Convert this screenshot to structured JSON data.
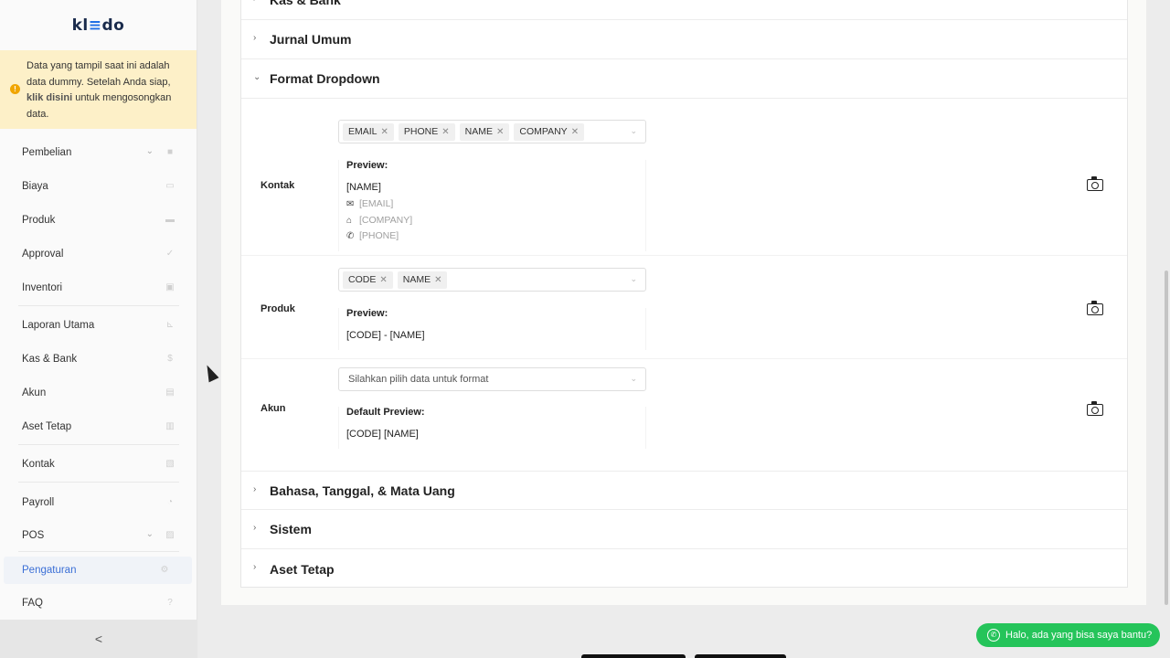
{
  "logo": {
    "text_a": "kl",
    "text_b": "≡",
    "text_c": "do"
  },
  "notice": {
    "text_before": "Data yang tampil saat ini adalah data dummy. Setelah Anda siap, ",
    "link": "klik disini",
    "text_after": " untuk mengosongkan data."
  },
  "sidebar": {
    "items": [
      {
        "label": "Pembelian",
        "icon": "bag-icon",
        "has_chevron": true
      },
      {
        "label": "Biaya",
        "icon": "card-icon"
      },
      {
        "label": "Produk",
        "icon": "box-icon"
      },
      {
        "label": "Approval",
        "icon": "check-icon"
      },
      {
        "label": "Inventori",
        "icon": "briefcase-icon"
      },
      {
        "label": "Laporan Utama",
        "icon": "chart-icon"
      },
      {
        "label": "Kas & Bank",
        "icon": "dollar-icon"
      },
      {
        "label": "Akun",
        "icon": "ledger-icon"
      },
      {
        "label": "Aset Tetap",
        "icon": "building-icon"
      },
      {
        "label": "Kontak",
        "icon": "contact-card-icon"
      },
      {
        "label": "Payroll",
        "icon": "payroll-icon"
      },
      {
        "label": "POS",
        "icon": "pos-icon",
        "has_chevron": true
      },
      {
        "label": "Pengaturan",
        "icon": "gears-icon",
        "active": true
      },
      {
        "label": "FAQ",
        "icon": "question-icon"
      }
    ],
    "collapse_label": "<"
  },
  "sections": {
    "kas_bank": "Kas & Bank",
    "jurnal_umum": "Jurnal Umum",
    "format_dropdown": "Format Dropdown",
    "bahasa": "Bahasa, Tanggal, & Mata Uang",
    "sistem": "Sistem",
    "aset_tetap": "Aset Tetap"
  },
  "format_rows": {
    "kontak": {
      "label": "Kontak",
      "tags": [
        "EMAIL",
        "PHONE",
        "NAME",
        "COMPANY"
      ],
      "preview_title": "Preview:",
      "preview_name": "[NAME]",
      "preview_email": "[EMAIL]",
      "preview_company": "[COMPANY]",
      "preview_phone": "[PHONE]"
    },
    "produk": {
      "label": "Produk",
      "tags": [
        "CODE",
        "NAME"
      ],
      "preview_title": "Preview:",
      "preview_value": "[CODE] - [NAME]"
    },
    "akun": {
      "label": "Akun",
      "placeholder": "Silahkan pilih data untuk format",
      "preview_title": "Default Preview:",
      "preview_value": "[CODE] [NAME]"
    }
  },
  "chat_button": "Halo, ada yang bisa saya bantu?"
}
